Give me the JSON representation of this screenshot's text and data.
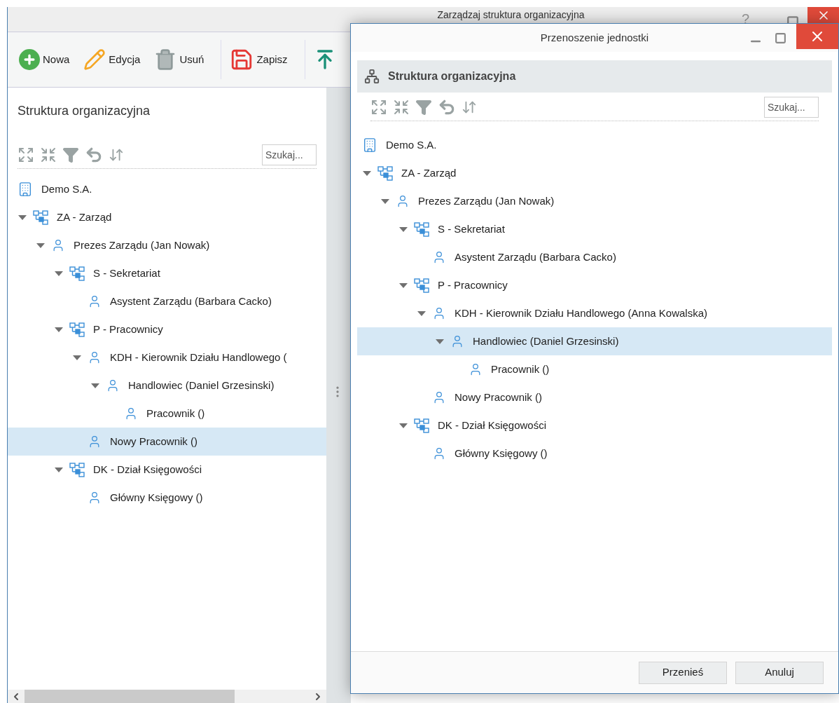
{
  "window": {
    "title": "Zarządzaj struktura organizacyjna",
    "help": "?"
  },
  "toolbar": [
    {
      "kind": "new",
      "label": "Nowa"
    },
    {
      "kind": "edit",
      "label": "Edycja"
    },
    {
      "kind": "delete",
      "label": "Usuń"
    },
    {
      "kind": "save",
      "label": "Zapisz"
    },
    {
      "kind": "move-top"
    }
  ],
  "panel": {
    "title": "Struktura organizacyjna",
    "search": {
      "placeholder": "Szukaj..."
    },
    "tree": [
      {
        "label": "Demo S.A.",
        "kind": "company",
        "selected": false
      },
      {
        "label": "ZA - Zarząd",
        "kind": "unit",
        "selected": false,
        "expanded": true,
        "children": [
          {
            "label": "Prezes Zarządu (Jan Nowak)",
            "kind": "person",
            "selected": false,
            "expanded": true,
            "children": [
              {
                "label": "S - Sekretariat",
                "kind": "unit",
                "selected": false,
                "expanded": true,
                "children": [
                  {
                    "label": "Asystent Zarządu (Barbara Cacko)",
                    "kind": "person",
                    "selected": false
                  }
                ]
              },
              {
                "label": "P - Pracownicy",
                "kind": "unit",
                "selected": false,
                "expanded": true,
                "children": [
                  {
                    "label": "KDH - Kierownik Działu Handlowego (",
                    "kind": "person",
                    "selected": false,
                    "expanded": true,
                    "children": [
                      {
                        "label": "Handlowiec (Daniel Grzesinski)",
                        "kind": "person",
                        "selected": false,
                        "expanded": true,
                        "children": [
                          {
                            "label": "Pracownik ()",
                            "kind": "person",
                            "selected": false
                          }
                        ]
                      }
                    ]
                  },
                  {
                    "label": "Nowy Pracownik ()",
                    "kind": "person",
                    "selected": true
                  }
                ]
              },
              {
                "label": "DK - Dział Księgowości",
                "kind": "unit",
                "selected": false,
                "expanded": true,
                "children": [
                  {
                    "label": "Główny Księgowy ()",
                    "kind": "person",
                    "selected": false
                  }
                ]
              }
            ]
          }
        ]
      }
    ]
  },
  "dialog": {
    "title": "Przenoszenie jednostki",
    "panel_title": "Struktura organizacyjna",
    "search": {
      "placeholder": "Szukaj..."
    },
    "tree": [
      {
        "label": "Demo S.A.",
        "kind": "company",
        "selected": false
      },
      {
        "label": "ZA - Zarząd",
        "kind": "unit",
        "selected": false,
        "expanded": true,
        "children": [
          {
            "label": "Prezes Zarządu (Jan Nowak)",
            "kind": "person",
            "selected": false,
            "expanded": true,
            "children": [
              {
                "label": "S - Sekretariat",
                "kind": "unit",
                "selected": false,
                "expanded": true,
                "children": [
                  {
                    "label": "Asystent Zarządu (Barbara Cacko)",
                    "kind": "person",
                    "selected": false
                  }
                ]
              },
              {
                "label": "P - Pracownicy",
                "kind": "unit",
                "selected": false,
                "expanded": true,
                "children": [
                  {
                    "label": "KDH - Kierownik Działu Handlowego (Anna Kowalska)",
                    "kind": "person",
                    "selected": false,
                    "expanded": true,
                    "children": [
                      {
                        "label": "Handlowiec (Daniel Grzesinski)",
                        "kind": "person",
                        "selected": true,
                        "expanded": true,
                        "children": [
                          {
                            "label": "Pracownik ()",
                            "kind": "person",
                            "selected": false
                          }
                        ]
                      }
                    ]
                  },
                  {
                    "label": "Nowy Pracownik ()",
                    "kind": "person",
                    "selected": false
                  }
                ]
              },
              {
                "label": "DK - Dział Księgowości",
                "kind": "unit",
                "selected": false,
                "expanded": true,
                "children": [
                  {
                    "label": "Główny Księgowy ()",
                    "kind": "person",
                    "selected": false
                  }
                ]
              }
            ]
          }
        ]
      }
    ],
    "buttons": [
      "Przenieś",
      "Anuluj"
    ]
  }
}
